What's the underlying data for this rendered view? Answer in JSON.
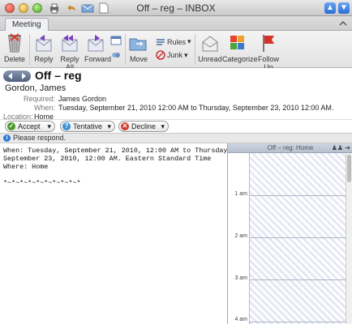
{
  "window": {
    "title": "Off – reg – INBOX"
  },
  "tabs": [
    {
      "label": "Meeting"
    }
  ],
  "ribbon": {
    "delete": "Delete",
    "reply": "Reply",
    "reply_all": "Reply All",
    "forward": "Forward",
    "move": "Move",
    "rules": "Rules",
    "junk": "Junk",
    "unread": "Unread",
    "categorize": "Categorize",
    "follow_up": "Follow Up"
  },
  "message": {
    "subject": "Off – reg",
    "sender": "Gordon, James",
    "required_label": "Required:",
    "required": "James Gordon",
    "when_label": "When:",
    "when": "Tuesday, September 21, 2010 12:00 AM to Thursday, September 23, 2010 12:00 AM.",
    "location_label": "Location:",
    "location": "Home"
  },
  "responses": {
    "accept": "Accept",
    "tentative": "Tentative",
    "decline": "Decline"
  },
  "info_bar": {
    "text": "Please respond."
  },
  "body": {
    "text": "When: Tuesday, September 21, 2010, 12:00 AM to Thursday,\nSeptember 23, 2010, 12:00 AM. Eastern Standard Time\nWhere: Home\n\n*~*~*~*~*~*~*~*~*~*"
  },
  "calendar": {
    "header": "Off – reg: Home",
    "times": [
      "1 am",
      "2 am",
      "3 am",
      "4 am"
    ]
  },
  "colors": {
    "accept": "#4a9a2c",
    "tentative": "#3a8fd0",
    "decline": "#d23a2a",
    "info": "#2f7ad6"
  }
}
